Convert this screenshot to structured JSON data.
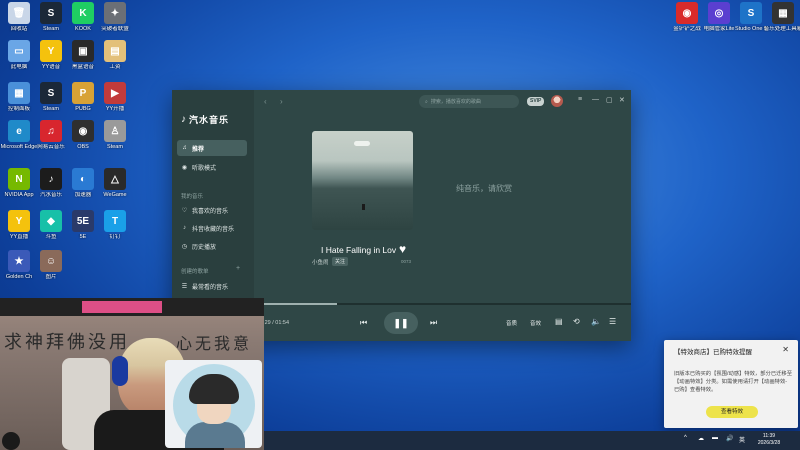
{
  "desktop": {
    "icons_left": [
      {
        "label": "回收站",
        "color": "#c9d6e8",
        "glyph": "🗑"
      },
      {
        "label": "Steam",
        "color": "#1b2838",
        "glyph": "S"
      },
      {
        "label": "KOOK",
        "color": "#1fce63",
        "glyph": "K"
      },
      {
        "label": "突破者联盟",
        "color": "#6b6f76",
        "glyph": "✦"
      },
      {
        "label": "此电脑",
        "color": "#6aa6e6",
        "glyph": "▭"
      },
      {
        "label": "YY语音",
        "color": "#f4c20d",
        "glyph": "Y"
      },
      {
        "label": "黑盒语音",
        "color": "#2a2a2a",
        "glyph": "▣"
      },
      {
        "label": "工资",
        "color": "#e3c07a",
        "glyph": "▤"
      },
      {
        "label": "控制面板",
        "color": "#4a90d9",
        "glyph": "▦"
      },
      {
        "label": "Steam",
        "color": "#1b2838",
        "glyph": "S"
      },
      {
        "label": "PUBG",
        "color": "#d8a236",
        "glyph": "P"
      },
      {
        "label": "YY开播",
        "color": "#c23b3b",
        "glyph": "▶"
      },
      {
        "label": "Microsoft Edge",
        "color": "#1f8ac9",
        "glyph": "e"
      },
      {
        "label": "网易云音乐",
        "color": "#d8262e",
        "glyph": "♫"
      },
      {
        "label": "OBS",
        "color": "#2f2f2f",
        "glyph": "◉"
      },
      {
        "label": "Steam",
        "color": "#9a9a9a",
        "glyph": "♙"
      },
      {
        "label": "NVIDIA App",
        "color": "#76b900",
        "glyph": "N"
      },
      {
        "label": "汽水音乐",
        "color": "#1c1c1c",
        "glyph": "♪"
      },
      {
        "label": "加速器",
        "color": "#2a7ad3",
        "glyph": "◐"
      },
      {
        "label": "WeGame",
        "color": "#2a2a2a",
        "glyph": "△"
      },
      {
        "label": "YY直播",
        "color": "#f4c20d",
        "glyph": "Y"
      },
      {
        "label": "斗鱼",
        "color": "#18c0a8",
        "glyph": "◆"
      },
      {
        "label": "5E",
        "color": "#2a3a6a",
        "glyph": "5E"
      },
      {
        "label": "钉钉",
        "color": "#1aa0e8",
        "glyph": "T"
      },
      {
        "label": "Golden Ch",
        "color": "#3b5ab8",
        "glyph": "★"
      },
      {
        "label": "图片",
        "color": "#8a6a5a",
        "glyph": "☺"
      }
    ],
    "icons_right": [
      {
        "label": "金铲铲之战",
        "color": "#d92b2b",
        "glyph": "◉"
      },
      {
        "label": "电脑管家Lite",
        "color": "#5a3fd0",
        "glyph": "◎"
      },
      {
        "label": "Studio One 5",
        "color": "#1e73c8",
        "glyph": "S"
      },
      {
        "label": "音乐处理工具箱",
        "color": "#333333",
        "glyph": "▦"
      }
    ]
  },
  "player": {
    "brand_name": "汽水音乐",
    "brand_icon": "music-note-icon",
    "search_placeholder": "搜索，播放喜欢的歌曲",
    "svip": "SVIP",
    "nav": [
      {
        "label": "推荐",
        "icon": "♫",
        "active": true
      },
      {
        "label": "听歌模式",
        "icon": "◉",
        "active": false
      }
    ],
    "section_mine": "我的音乐",
    "mine_items": [
      {
        "label": "我喜欢的音乐",
        "icon": "♡"
      },
      {
        "label": "抖音收藏的音乐",
        "icon": "♪"
      },
      {
        "label": "历史播放",
        "icon": "◷"
      }
    ],
    "section_created": "创建的歌单",
    "created_plus": "+",
    "created_items": [
      {
        "label": "最常看的音乐",
        "icon": "☰"
      }
    ],
    "song": {
      "title": "I Hate Falling in Lov",
      "artist": "小鱼闹",
      "follow": "关注",
      "code": "0073"
    },
    "pure_music_text": "纯音乐，请欣赏",
    "time": "1:29 / 01:54",
    "progress": 0.22,
    "controls": {
      "quality": "音质",
      "effect": "音效"
    }
  },
  "notification": {
    "title": "【特效商店】已购特效提醒",
    "body": "旧版本已购买的【氛围/动感】特效，部分已迁移至【动画特效】分类。如需使用请打开【动画特效-已购】查看特效。",
    "button": "查看特效"
  },
  "taskbar": {
    "tray_icons": [
      "^",
      "☁",
      "▬",
      "🔊",
      "英"
    ],
    "time": "11:39",
    "date": "2026/3/28"
  },
  "overlay": {
    "calligraphy_left": "求神拜佛没用",
    "calligraphy_right": "心无我意"
  }
}
